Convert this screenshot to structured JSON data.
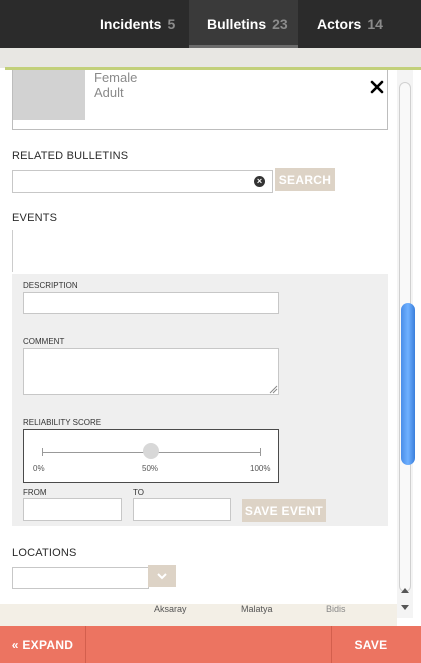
{
  "nav": {
    "tabs": [
      {
        "label": "Incidents",
        "count": "5"
      },
      {
        "label": "Bulletins",
        "count": "23"
      },
      {
        "label": "Actors",
        "count": "14"
      }
    ]
  },
  "actor": {
    "sex": "Female",
    "age": "Adult"
  },
  "related_bulletins": {
    "label": "RELATED BULLETINS",
    "search_value": "",
    "search_button": "SEARCH"
  },
  "events": {
    "label": "EVENTS",
    "description_label": "DESCRIPTION",
    "description_value": "",
    "comment_label": "COMMENT",
    "comment_value": "",
    "reliability": {
      "label": "RELIABILITY SCORE",
      "min_label": "0%",
      "mid_label": "50%",
      "max_label": "100%",
      "value_fraction": 0.5
    },
    "from_label": "FROM",
    "from_value": "",
    "to_label": "TO",
    "to_value": "",
    "save_event_button": "SAVE EVENT"
  },
  "locations": {
    "label": "LOCATIONS",
    "value": ""
  },
  "map": {
    "labels": [
      "Aksaray",
      "Malatya",
      "Bidis"
    ]
  },
  "bottom": {
    "expand_label": "« EXPAND",
    "save_label": "SAVE"
  },
  "colors": {
    "accent_green": "#c2d07a",
    "save_bar": "#ec7461",
    "button_tan": "#ddd3c6",
    "nav_bg": "#2b2b2b"
  },
  "icons": [
    "close-icon",
    "clear-icon",
    "chevron-down-icon"
  ]
}
